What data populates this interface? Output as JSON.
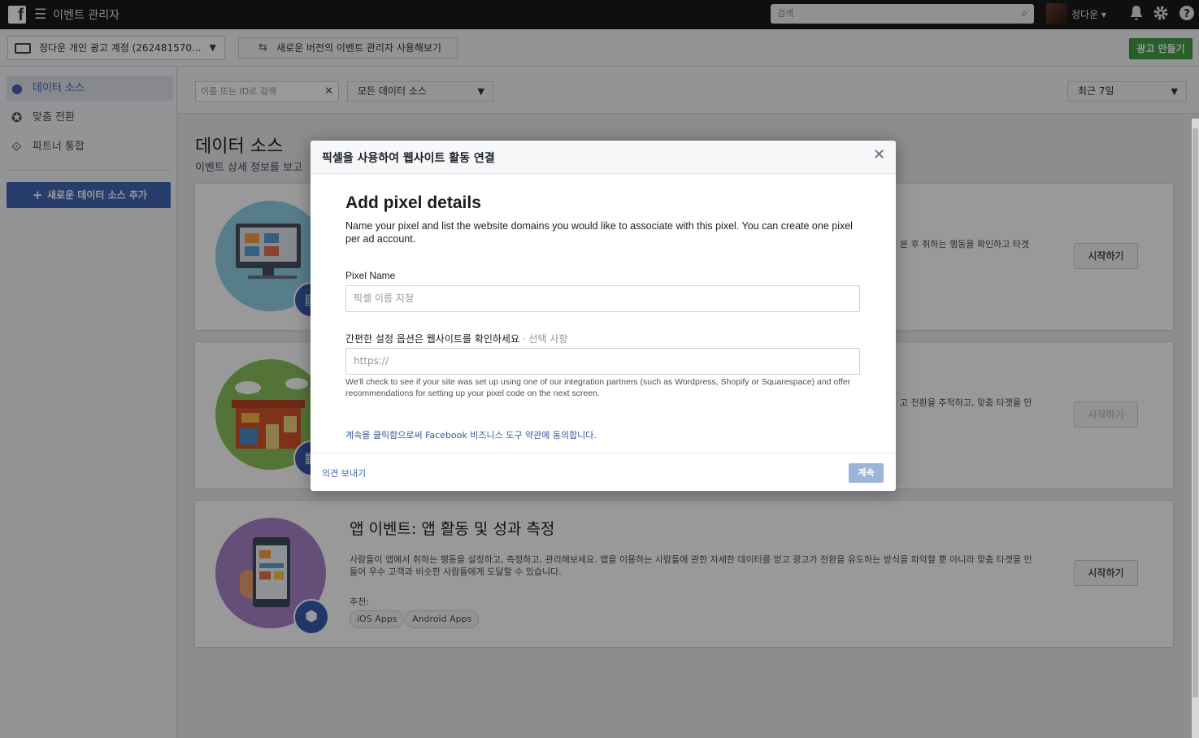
{
  "topbar": {
    "logo": "f",
    "menu_icon": "☰",
    "app_title": "이벤트 관리자",
    "search_placeholder": "검색",
    "user_name": "정다운 ▾",
    "icons": [
      "bell-icon",
      "gear-icon",
      "help-icon"
    ]
  },
  "subbar": {
    "account": "정다운 개인 광고 계정 (262481570...",
    "switch_version": "새로운 버전의 이벤트 관리자 사용해보기",
    "create_ad": "광고 만들기"
  },
  "sidebar": {
    "items": [
      {
        "label": "데이터 소스",
        "icon": "people-icon",
        "active": true
      },
      {
        "label": "맞춤 전환",
        "icon": "star-icon",
        "active": false
      },
      {
        "label": "파트너 통합",
        "icon": "handshake-icon",
        "active": false
      }
    ],
    "add_source": "새로운 데이터 소스 추가"
  },
  "filters": {
    "search_placeholder": "이름 또는 ID로 검색",
    "source_select": "모든 데이터 소스",
    "date_select": "최근 7일"
  },
  "main": {
    "title": "데이터 소스",
    "subtitle": "이벤트 상세 정보를 보고"
  },
  "cards": [
    {
      "desc_tail": "본 후 취하는 행동을 확인하고 타겟",
      "button": "시작하기",
      "disabled": false
    },
    {
      "desc_tail": "고 전환을 추적하고, 맞춤 타겟을 만",
      "button": "시작하기",
      "disabled": true
    },
    {
      "title": "앱 이벤트: 앱 활동 및 성과 측정",
      "desc": "사람들이 앱에서 취하는 행동을 설정하고, 측정하고, 관리해보세요. 앱을 이용하는 사람들에 관한 자세한 데이터를 얻고 광고가 전환을 유도하는 방식을 파악할 뿐 아니라 맞춤 타겟을 만들어 우수 고객과 비슷한 사람들에게 도달할 수 있습니다.",
      "recommend_label": "추천:",
      "chips": [
        "iOS Apps",
        "Android Apps"
      ],
      "button": "시작하기",
      "disabled": false
    }
  ],
  "modal": {
    "title": "픽셀을 사용하여 웹사이트 활동 연결",
    "heading": "Add pixel details",
    "description": "Name your pixel and list the website domains you would like to associate with this pixel. You can create one pixel per ad account.",
    "pixel_name_label": "Pixel Name",
    "pixel_name_placeholder": "픽셀 이름 지정",
    "website_label": "간편한 설정 옵션은 웹사이트를 확인하세요",
    "website_optional": " · 선택 사항",
    "website_placeholder": "https://",
    "help_text": "We'll check to see if your site was set up using one of our integration partners (such as Wordpress, Shopify or Squarespace) and offer recommendations for setting up your pixel code on the next screen.",
    "terms": "계속을 클릭함으로써 Facebook 비즈니스 도구 약관에 동의합니다.",
    "feedback": "의견 보내기",
    "continue": "계속"
  }
}
